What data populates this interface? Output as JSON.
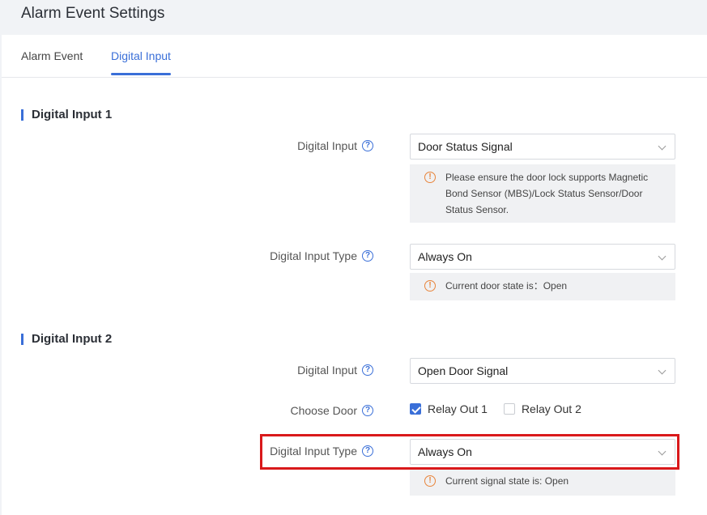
{
  "header": {
    "title": "Alarm Event Settings"
  },
  "tabs": [
    {
      "label": "Alarm Event",
      "active": false
    },
    {
      "label": "Digital Input",
      "active": true
    }
  ],
  "section1": {
    "title": "Digital Input 1",
    "digital_input": {
      "label": "Digital Input",
      "value": "Door Status Signal",
      "notice": "Please ensure the door lock supports Magnetic Bond Sensor (MBS)/Lock Status Sensor/Door Status Sensor."
    },
    "digital_input_type": {
      "label": "Digital Input Type",
      "value": "Always On",
      "notice": "Current door state is：Open"
    }
  },
  "section2": {
    "title": "Digital Input 2",
    "digital_input": {
      "label": "Digital Input",
      "value": "Open Door Signal"
    },
    "choose_door": {
      "label": "Choose Door",
      "options": [
        {
          "label": "Relay Out 1",
          "checked": true
        },
        {
          "label": "Relay Out 2",
          "checked": false
        }
      ]
    },
    "digital_input_type": {
      "label": "Digital Input Type",
      "value": "Always On",
      "notice": "Current signal state is: Open"
    }
  },
  "icons": {
    "help": "question-circle-icon",
    "warning": "exclamation-circle-icon",
    "dropdown": "chevron-down-icon"
  },
  "colors": {
    "accent": "#3a6fd8",
    "warning": "#e8843a",
    "highlight": "#d9191b"
  }
}
